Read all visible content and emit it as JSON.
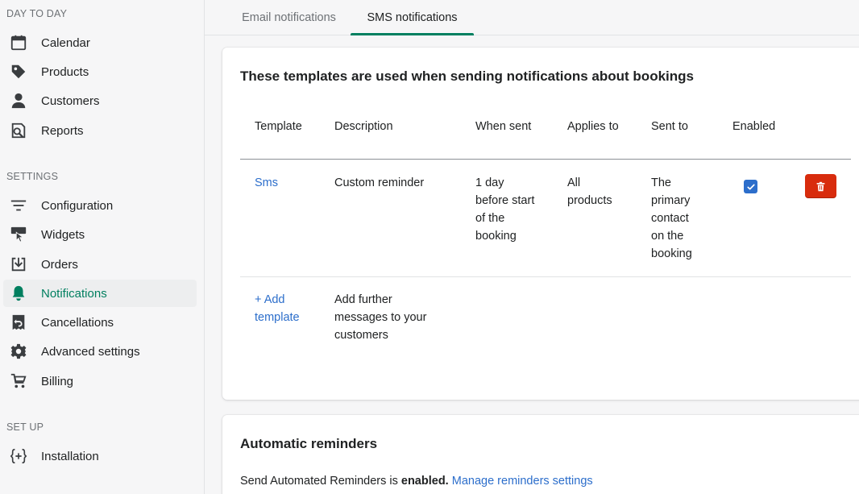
{
  "sidebar": {
    "sections": [
      {
        "title": "DAY TO DAY"
      },
      {
        "title": "SETTINGS"
      },
      {
        "title": "SET UP"
      }
    ],
    "items": [
      {
        "label": "Calendar",
        "icon": "calendar-icon"
      },
      {
        "label": "Products",
        "icon": "tag-icon"
      },
      {
        "label": "Customers",
        "icon": "person-icon"
      },
      {
        "label": "Reports",
        "icon": "reports-icon"
      },
      {
        "label": "Configuration",
        "icon": "sliders-icon"
      },
      {
        "label": "Widgets",
        "icon": "widget-icon"
      },
      {
        "label": "Orders",
        "icon": "inbox-icon"
      },
      {
        "label": "Notifications",
        "icon": "bell-icon",
        "active": true
      },
      {
        "label": "Cancellations",
        "icon": "return-icon"
      },
      {
        "label": "Advanced settings",
        "icon": "gear-icon"
      },
      {
        "label": "Billing",
        "icon": "cart-icon"
      },
      {
        "label": "Installation",
        "icon": "code-icon"
      }
    ]
  },
  "tabs": [
    {
      "label": "Email notifications"
    },
    {
      "label": "SMS notifications",
      "active": true
    }
  ],
  "templates_card": {
    "heading": "These templates are used when sending notifications about bookings",
    "headers": [
      "Template",
      "Description",
      "When sent",
      "Applies to",
      "Sent to",
      "Enabled"
    ],
    "rows": [
      {
        "template": "Sms",
        "description": "Custom reminder",
        "when_sent": [
          "1 day",
          "before start",
          "of the",
          "booking"
        ],
        "applies_to": [
          "All",
          "products"
        ],
        "sent_to": [
          "The",
          "primary",
          "contact",
          "on the",
          "booking"
        ],
        "enabled": true
      }
    ],
    "add_template": [
      "+ Add",
      "template"
    ],
    "add_description": [
      "Add further",
      "messages to your",
      "customers"
    ]
  },
  "reminders_card": {
    "heading": "Automatic reminders",
    "text_prefix": "Send Automated Reminders is ",
    "status": "enabled.",
    "link": "Manage reminders settings"
  },
  "colors": {
    "accent": "#008060",
    "active_nav": "#007f5f",
    "link": "#2c6ecb",
    "danger": "#d82c0d"
  }
}
